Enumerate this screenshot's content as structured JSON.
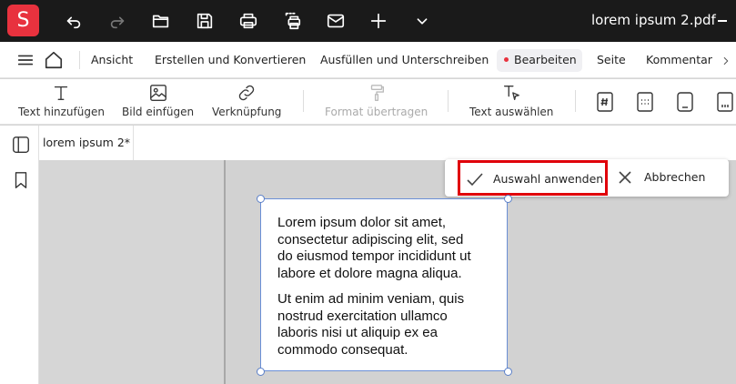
{
  "app": {
    "logo_letter": "S",
    "document_title": "lorem ipsum 2.pdf"
  },
  "titlebar_icons": [
    "undo-icon",
    "redo-icon",
    "folder-icon",
    "save-icon",
    "print-icon",
    "scan-icon",
    "mail-icon",
    "plus-icon",
    "chevron-down-icon"
  ],
  "menu": {
    "items": [
      "Ansicht",
      "Erstellen und Konvertieren",
      "Ausfüllen und Unterschreiben",
      "Bearbeiten",
      "Seite",
      "Kommentar"
    ],
    "active": "Bearbeiten"
  },
  "toolbar": {
    "add_text": "Text hinzufügen",
    "insert_image": "Bild einfügen",
    "link": "Verknüpfung",
    "format_painter": "Format übertragen",
    "select_text": "Text auswählen"
  },
  "tab": {
    "label": "lorem ipsum 2*"
  },
  "popup": {
    "apply": "Auswahl anwenden",
    "cancel": "Abbrechen"
  },
  "textbox": {
    "paragraph1_lines": [
      "Lorem ipsum dolor sit amet,",
      "consectetur adipiscing elit, sed",
      "do eiusmod tempor incididunt ut",
      "labore et dolore magna aliqua."
    ],
    "paragraph2_lines": [
      "Ut enim ad minim veniam, quis",
      "nostrud exercitation ullamco",
      "laboris nisi ut aliquip ex ea",
      "commodo consequat."
    ]
  },
  "colors": {
    "accent_red": "#e8323e",
    "highlight_border": "#e0000a",
    "selection_blue": "#5a7fc8"
  }
}
